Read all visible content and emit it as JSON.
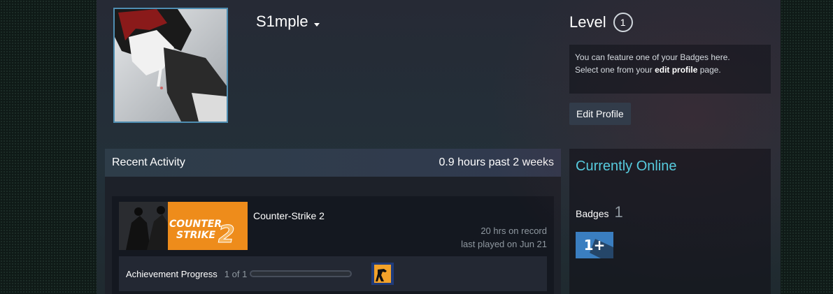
{
  "profile": {
    "persona_name": "S1mple",
    "level_label": "Level",
    "level": "1",
    "feature_text_1": "You can feature one of your Badges here.",
    "feature_text_2_prefix": "Select one from your ",
    "feature_link": "edit profile",
    "feature_text_2_suffix": " page.",
    "edit_button": "Edit Profile"
  },
  "recent_activity": {
    "title": "Recent Activity",
    "summary": "0.9 hours past 2 weeks",
    "game": {
      "name": "Counter-Strike 2",
      "capsule_line1": "COUNTER",
      "capsule_line2": "STRIKE",
      "capsule_number": "2",
      "hours": "20 hrs on record",
      "last_played": "last played on Jun 21",
      "achievement_label": "Achievement Progress",
      "achievement_count": "1 of 1",
      "achievement_progress": 0.0
    }
  },
  "sidebar": {
    "status": "Currently Online",
    "badges_label": "Badges",
    "badges_count": "1",
    "badge_icon_text": "1+"
  },
  "colors": {
    "online_blue": "#57cbde",
    "avatar_border": "#4f8eb2",
    "capsule_orange": "#ee8c1b"
  }
}
